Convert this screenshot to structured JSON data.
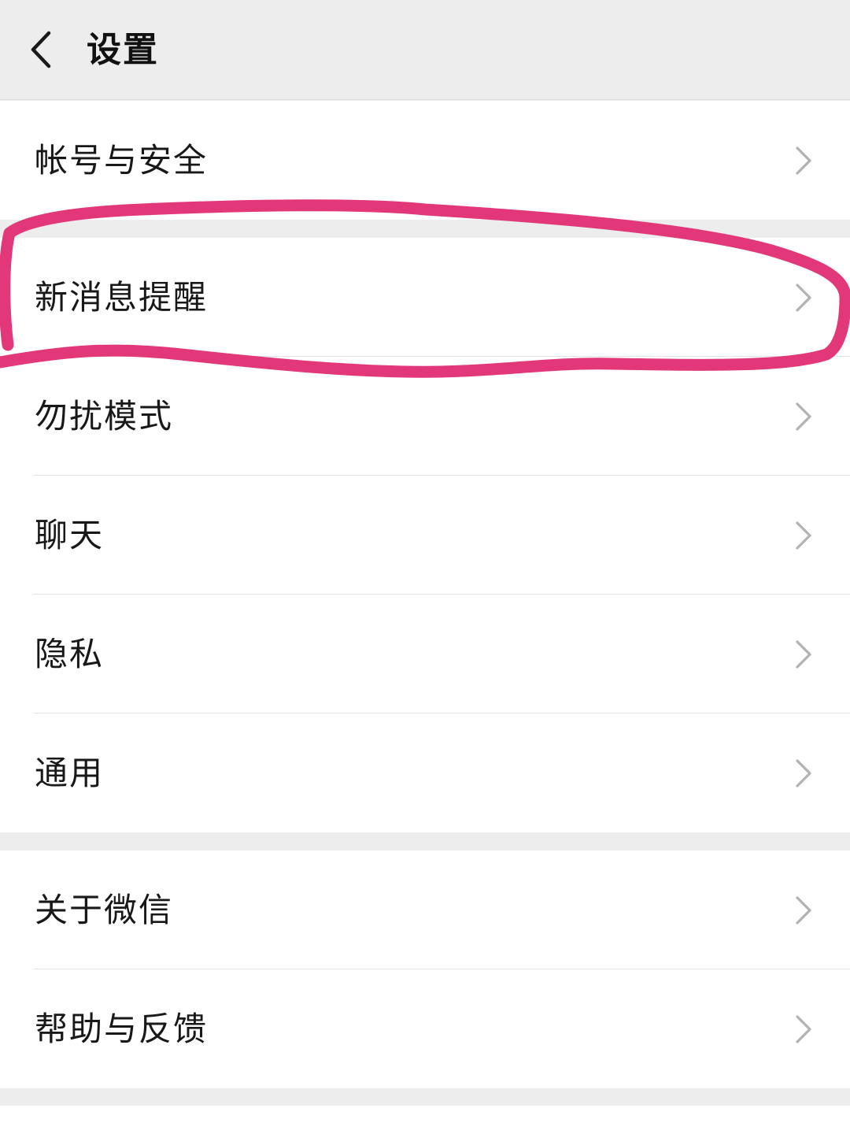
{
  "header": {
    "title": "设置"
  },
  "groups": [
    {
      "items": [
        {
          "label": "帐号与安全"
        }
      ]
    },
    {
      "items": [
        {
          "label": "新消息提醒"
        },
        {
          "label": "勿扰模式"
        },
        {
          "label": "聊天"
        },
        {
          "label": "隐私"
        },
        {
          "label": "通用"
        }
      ]
    },
    {
      "items": [
        {
          "label": "关于微信"
        },
        {
          "label": "帮助与反馈"
        }
      ]
    }
  ],
  "icons": {
    "back": "chevron-left-icon",
    "row_arrow": "chevron-right-icon"
  },
  "colors": {
    "background": "#ededed",
    "card": "#ffffff",
    "text": "#181818",
    "chevron": "#b2b2b2",
    "annotation": "#e2387a"
  }
}
